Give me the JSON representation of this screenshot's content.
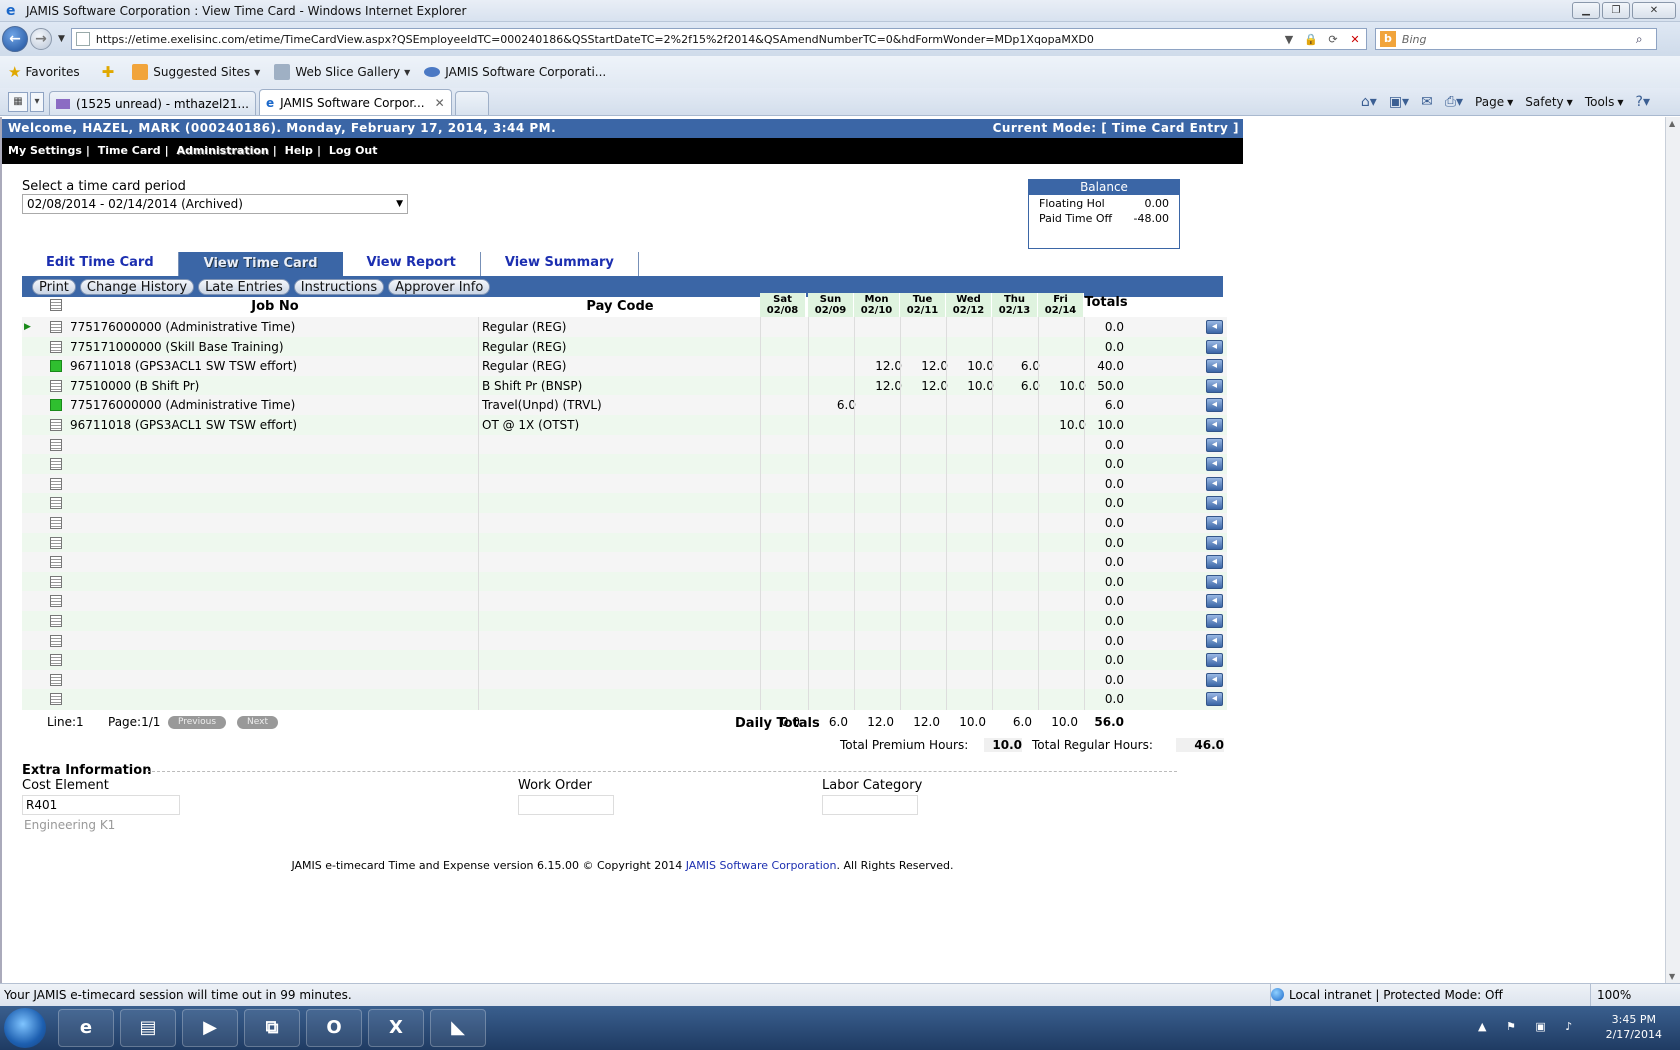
{
  "browser": {
    "window_title": "JAMIS Software Corporation : View Time Card - Windows Internet Explorer",
    "url": "https://etime.exelisinc.com/etime/TimeCardView.aspx?QSEmployeeIdTC=000240186&QSStartDateTC=2%2f15%2f2014&QSAmendNumberTC=0&hdFormWonder=MDp1XqopaMXD0",
    "search_placeholder": "Bing",
    "favorites_label": "Favorites",
    "favorites": [
      "Suggested Sites",
      "Web Slice Gallery",
      "JAMIS Software Corporati..."
    ],
    "tabs": [
      {
        "label": "(1525 unread) - mthazel21..."
      },
      {
        "label": "JAMIS Software Corpor..."
      }
    ],
    "commands": [
      "Page",
      "Safety",
      "Tools"
    ]
  },
  "app": {
    "welcome": "Welcome, HAZEL, MARK (000240186). Monday, February 17, 2014, 3:44 PM.",
    "current_mode": "Current Mode: [ Time Card Entry ]",
    "menu": [
      "My Settings",
      "Time Card",
      "Administration",
      "Help",
      "Log Out"
    ],
    "period_label": "Select a time card period",
    "period_value": "02/08/2014 - 02/14/2014 (Archived)",
    "balance": {
      "title": "Balance",
      "rows": [
        {
          "label": "Floating Hol",
          "value": "0.00"
        },
        {
          "label": "Paid Time Off",
          "value": "-48.00"
        }
      ]
    },
    "tabs": [
      "Edit Time Card",
      "View Time Card",
      "View Report",
      "View Summary"
    ],
    "active_tab": "View Time Card",
    "toolbar": [
      "Print",
      "Change History",
      "Late Entries",
      "Instructions",
      "Approver Info"
    ],
    "grid": {
      "col_job": "Job No",
      "col_pay": "Pay Code",
      "col_totals": "Totals",
      "days": [
        {
          "dow": "Sat",
          "date": "02/08"
        },
        {
          "dow": "Sun",
          "date": "02/09"
        },
        {
          "dow": "Mon",
          "date": "02/10"
        },
        {
          "dow": "Tue",
          "date": "02/11"
        },
        {
          "dow": "Wed",
          "date": "02/12"
        },
        {
          "dow": "Thu",
          "date": "02/13"
        },
        {
          "dow": "Fri",
          "date": "02/14"
        }
      ],
      "rows": [
        {
          "job": "775176000000 (Administrative Time)",
          "pay": "Regular (REG)",
          "hours": [
            "",
            "",
            "",
            "",
            "",
            "",
            ""
          ],
          "total": "0.0",
          "icon": "note",
          "current": true
        },
        {
          "job": "775171000000 (Skill Base Training)",
          "pay": "Regular (REG)",
          "hours": [
            "",
            "",
            "",
            "",
            "",
            "",
            ""
          ],
          "total": "0.0",
          "icon": "note"
        },
        {
          "job": "96711018 (GPS3ACL1 SW TSW effort)",
          "pay": "Regular (REG)",
          "hours": [
            "",
            "",
            "12.0",
            "12.0",
            "10.0",
            "6.0",
            ""
          ],
          "total": "40.0",
          "icon": "green"
        },
        {
          "job": "77510000 (B Shift Pr)",
          "pay": "B Shift Pr (BNSP)",
          "hours": [
            "",
            "",
            "12.0",
            "12.0",
            "10.0",
            "6.0",
            "10.0"
          ],
          "total": "50.0",
          "icon": "note"
        },
        {
          "job": "775176000000 (Administrative Time)",
          "pay": "Travel(Unpd) (TRVL)",
          "hours": [
            "",
            "6.0",
            "",
            "",
            "",
            "",
            ""
          ],
          "total": "6.0",
          "icon": "green"
        },
        {
          "job": "96711018 (GPS3ACL1 SW TSW effort)",
          "pay": "OT @ 1X (OTST)",
          "hours": [
            "",
            "",
            "",
            "",
            "",
            "",
            "10.0"
          ],
          "total": "10.0",
          "icon": "note"
        },
        {
          "job": "",
          "pay": "",
          "hours": [
            "",
            "",
            "",
            "",
            "",
            "",
            ""
          ],
          "total": "0.0",
          "icon": "note"
        },
        {
          "job": "",
          "pay": "",
          "hours": [
            "",
            "",
            "",
            "",
            "",
            "",
            ""
          ],
          "total": "0.0",
          "icon": "note"
        },
        {
          "job": "",
          "pay": "",
          "hours": [
            "",
            "",
            "",
            "",
            "",
            "",
            ""
          ],
          "total": "0.0",
          "icon": "note"
        },
        {
          "job": "",
          "pay": "",
          "hours": [
            "",
            "",
            "",
            "",
            "",
            "",
            ""
          ],
          "total": "0.0",
          "icon": "note"
        },
        {
          "job": "",
          "pay": "",
          "hours": [
            "",
            "",
            "",
            "",
            "",
            "",
            ""
          ],
          "total": "0.0",
          "icon": "note"
        },
        {
          "job": "",
          "pay": "",
          "hours": [
            "",
            "",
            "",
            "",
            "",
            "",
            ""
          ],
          "total": "0.0",
          "icon": "note"
        },
        {
          "job": "",
          "pay": "",
          "hours": [
            "",
            "",
            "",
            "",
            "",
            "",
            ""
          ],
          "total": "0.0",
          "icon": "note"
        },
        {
          "job": "",
          "pay": "",
          "hours": [
            "",
            "",
            "",
            "",
            "",
            "",
            ""
          ],
          "total": "0.0",
          "icon": "note"
        },
        {
          "job": "",
          "pay": "",
          "hours": [
            "",
            "",
            "",
            "",
            "",
            "",
            ""
          ],
          "total": "0.0",
          "icon": "note"
        },
        {
          "job": "",
          "pay": "",
          "hours": [
            "",
            "",
            "",
            "",
            "",
            "",
            ""
          ],
          "total": "0.0",
          "icon": "note"
        },
        {
          "job": "",
          "pay": "",
          "hours": [
            "",
            "",
            "",
            "",
            "",
            "",
            ""
          ],
          "total": "0.0",
          "icon": "note"
        },
        {
          "job": "",
          "pay": "",
          "hours": [
            "",
            "",
            "",
            "",
            "",
            "",
            ""
          ],
          "total": "0.0",
          "icon": "note"
        },
        {
          "job": "",
          "pay": "",
          "hours": [
            "",
            "",
            "",
            "",
            "",
            "",
            ""
          ],
          "total": "0.0",
          "icon": "note"
        },
        {
          "job": "",
          "pay": "",
          "hours": [
            "",
            "",
            "",
            "",
            "",
            "",
            ""
          ],
          "total": "0.0",
          "icon": "note"
        }
      ]
    },
    "pager": {
      "line": "Line:1",
      "page": "Page:1/1",
      "previous": "Previous",
      "next": "Next"
    },
    "daily_totals": {
      "label": "Daily Totals",
      "values": [
        "0.0",
        "6.0",
        "12.0",
        "12.0",
        "10.0",
        "6.0",
        "10.0"
      ],
      "grand_total": "56.0"
    },
    "premium": {
      "premium_label": "Total Premium Hours:",
      "premium_value": "10.0",
      "regular_label": "Total Regular Hours:",
      "regular_value": "46.0"
    },
    "extra": {
      "title": "Extra Information",
      "cost_element_label": "Cost Element",
      "cost_element_value": "R401",
      "cost_element_desc": "Engineering K1",
      "work_order_label": "Work Order",
      "labor_category_label": "Labor Category"
    },
    "footer": {
      "prefix": "JAMIS e-timecard Time and Expense version 6.15.00 © Copyright 2014",
      "corp": "JAMIS Software Corporation",
      "suffix": ". All Rights Reserved."
    }
  },
  "status": {
    "message": "Your JAMIS e-timecard session will time out in 99 minutes.",
    "zone": "Local intranet | Protected Mode: Off",
    "zoom": "100%"
  },
  "taskbar": {
    "time": "3:45 PM",
    "date": "2/17/2014"
  }
}
